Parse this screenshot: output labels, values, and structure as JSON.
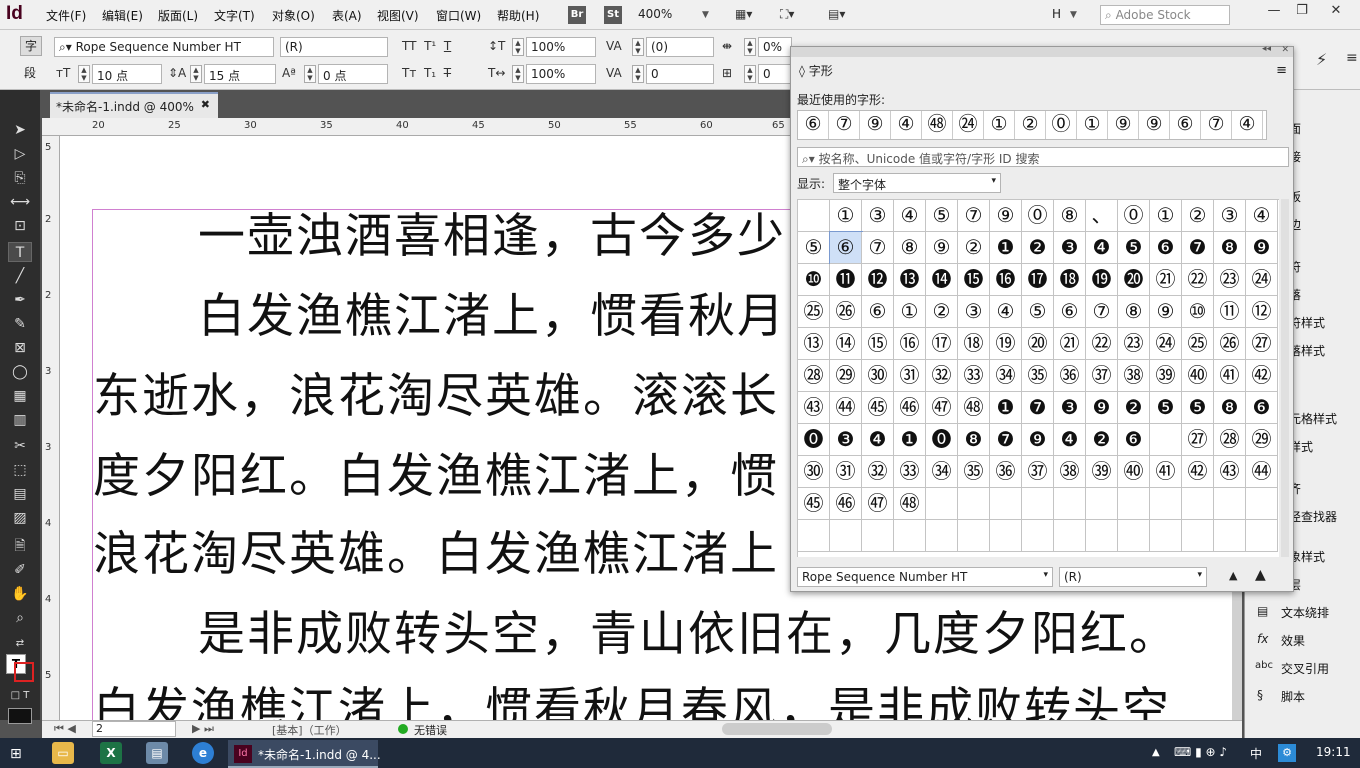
{
  "app": {
    "logo": "Id",
    "menus": [
      "文件(F)",
      "编辑(E)",
      "版面(L)",
      "文字(T)",
      "对象(O)",
      "表(A)",
      "视图(V)",
      "窗口(W)",
      "帮助(H)"
    ],
    "bridge": "Br",
    "stock_badge": "St",
    "zoom": "400%",
    "workspace": "H",
    "search_placeholder": "Adobe Stock"
  },
  "control": {
    "char_label": "字",
    "para_label": "段",
    "font": "Rope Sequence Number HT",
    "style": "(R)",
    "size": "10 点",
    "leading": "15 点",
    "scale_v": "100%",
    "scale_h": "100%",
    "kerning": "(0)",
    "tracking": "0",
    "baseline": "0 点",
    "tsume": "0%",
    "skew": "0"
  },
  "document": {
    "tab": "*未命名-1.indd @ 400%",
    "ruler_h": [
      "20",
      "25",
      "30",
      "35",
      "40",
      "45",
      "50",
      "55",
      "60",
      "65"
    ],
    "ruler_v": [
      "5",
      "2",
      "2",
      "3",
      "3",
      "4",
      "4",
      "5"
    ],
    "lines": [
      "一壶浊酒喜相逢，古今多少",
      "白发渔樵江渚上，惯看秋月",
      "东逝水，浪花淘尽英雄。滚滚长",
      "度夕阳红。白发渔樵江渚上，惯",
      "浪花淘尽英雄。白发渔樵江渚上",
      "是非成败转头空，青山依旧在，几度夕阳红。",
      "白发渔樵江渚上，惯看秋月春风，是非成败转头空"
    ]
  },
  "status": {
    "page": "2",
    "profile": "[基本]（工作）",
    "preflight": "无错误"
  },
  "glyphs_panel": {
    "title": "字形",
    "recent_label": "最近使用的字形:",
    "recent": [
      "⑥",
      "⑦",
      "⑨",
      "④",
      "㊽",
      "㉔",
      "①",
      "②",
      "⓪",
      "①",
      "⑨",
      "⑨",
      "⑥",
      "⑦",
      "④"
    ],
    "search_placeholder": "按名称、Unicode 值或字符/字形 ID 搜索",
    "show_label": "显示:",
    "show_value": "整个字体",
    "grid": [
      [
        "",
        "①",
        "③",
        "④",
        "⑤",
        "⑦",
        "⑨",
        "⓪",
        "⑧",
        "、",
        "⓪",
        "①",
        "②",
        "③",
        "④"
      ],
      [
        "⑤",
        "⑥",
        "⑦",
        "⑧",
        "⑨",
        "②",
        "❶",
        "❷",
        "❸",
        "❹",
        "❺",
        "❻",
        "❼",
        "❽",
        "❾"
      ],
      [
        "❿",
        "⓫",
        "⓬",
        "⓭",
        "⓮",
        "⓯",
        "⓰",
        "⓱",
        "⓲",
        "⓳",
        "⓴",
        "㉑",
        "㉒",
        "㉓",
        "㉔"
      ],
      [
        "㉕",
        "㉖",
        "⑥",
        "①",
        "②",
        "③",
        "④",
        "⑤",
        "⑥",
        "⑦",
        "⑧",
        "⑨",
        "⑩",
        "⑪",
        "⑫"
      ],
      [
        "⑬",
        "⑭",
        "⑮",
        "⑯",
        "⑰",
        "⑱",
        "⑲",
        "⑳",
        "㉑",
        "㉒",
        "㉓",
        "㉔",
        "㉕",
        "㉖",
        "㉗"
      ],
      [
        "㉘",
        "㉙",
        "㉚",
        "㉛",
        "㉜",
        "㉝",
        "㉞",
        "㉟",
        "㊱",
        "㊲",
        "㊳",
        "㊴",
        "㊵",
        "㊶",
        "㊷"
      ],
      [
        "㊸",
        "㊹",
        "㊺",
        "㊻",
        "㊼",
        "㊽",
        "❶",
        "❼",
        "❸",
        "❾",
        "❷",
        "❺",
        "❺",
        "❽",
        "❻"
      ],
      [
        "⓿",
        "❸",
        "❹",
        "❶",
        "⓿",
        "❽",
        "❼",
        "❾",
        "❹",
        "❷",
        "❻",
        "",
        "㉗",
        "㉘",
        "㉙"
      ],
      [
        "㉚",
        "㉛",
        "㉜",
        "㉝",
        "㉞",
        "㉟",
        "㊱",
        "㊲",
        "㊳",
        "㊴",
        "㊵",
        "㊶",
        "㊷",
        "㊸",
        "㊹"
      ],
      [
        "㊺",
        "㊻",
        "㊼",
        "㊽",
        "",
        "",
        "",
        "",
        "",
        "",
        "",
        "",
        "",
        "",
        ""
      ],
      [
        "",
        "",
        "",
        "",
        "",
        "",
        "",
        "",
        "",
        "",
        "",
        "",
        "",
        "",
        ""
      ]
    ],
    "footer_font": "Rope Sequence Number HT",
    "footer_style": "(R)"
  },
  "right_panel": [
    "页面",
    "链接",
    "描边",
    "颜色",
    "色板",
    "字符",
    "段落",
    "字符样式",
    "段落样式",
    "",
    "单元格样式",
    "表样式",
    "",
    "对齐",
    "路径查找器",
    "",
    "对象样式",
    "图层",
    "文本绕排",
    "效果",
    "交叉引用",
    "脚本"
  ],
  "right_panel_visible": [
    "面",
    "接",
    "板",
    "边",
    "",
    "符",
    "落",
    "符样式",
    "落样式",
    "",
    "元格样式",
    "样式",
    "",
    "齐",
    "径查找器",
    "",
    "象样式",
    "层",
    "文本绕排",
    "效果",
    "交叉引用",
    "脚本"
  ],
  "taskbar": {
    "app": "*未命名-1.indd @ 4...",
    "time": "19:11",
    "ime": "中"
  }
}
